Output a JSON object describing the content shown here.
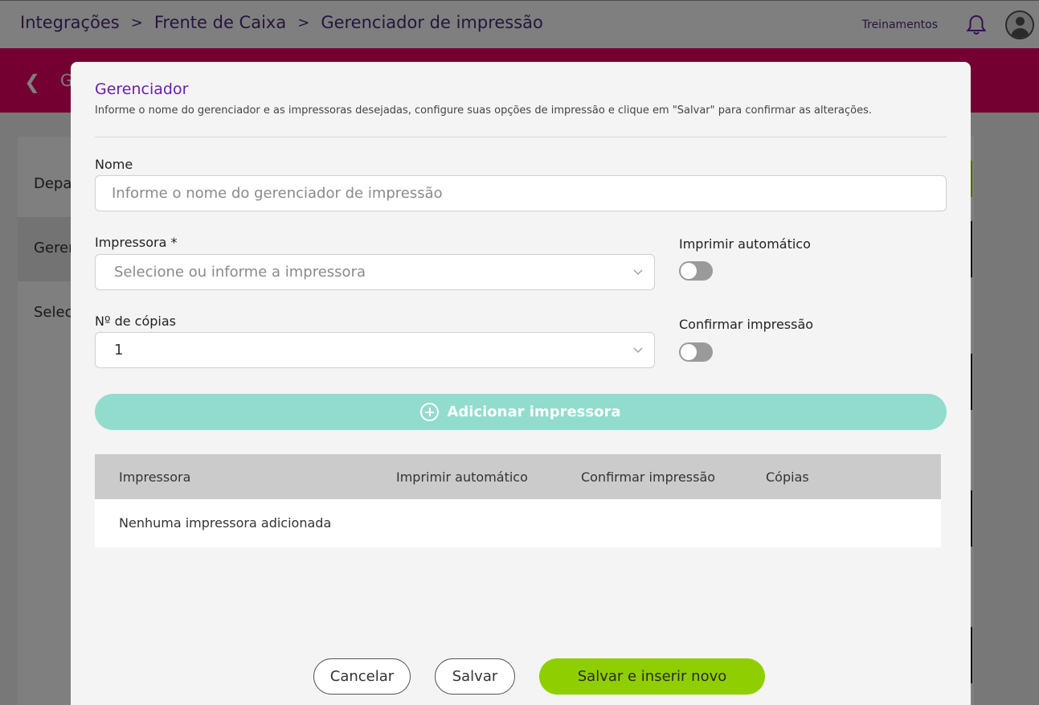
{
  "header": {
    "breadcrumb": [
      "Integrações",
      "Frente de Caixa",
      "Gerenciador de impressão"
    ],
    "breadcrumb_separator": ">",
    "training_link": "Treinamentos",
    "bell_icon": "bell-icon",
    "avatar_icon": "user-avatar-icon"
  },
  "subheader": {
    "back_icon": "chevron-left-icon",
    "title_partial": "G"
  },
  "background_sidebar": {
    "items": [
      "Depa",
      "Gerer",
      "Selec"
    ],
    "active_index": 1
  },
  "modal": {
    "title": "Gerenciador",
    "description": "Informe o nome do gerenciador e as impressoras desejadas, configure suas opções de impressão e clique em \"Salvar\" para confirmar as alterações.",
    "name_label": "Nome",
    "name_value": "",
    "name_placeholder": "Informe o nome do gerenciador de impressão",
    "printer_label": "Impressora *",
    "printer_placeholder": "Selecione ou informe a impressora",
    "copies_label": "Nº de cópias",
    "copies_value": "1",
    "auto_print_label": "Imprimir automático",
    "auto_print_on": false,
    "confirm_print_label": "Confirmar impressão",
    "confirm_print_on": false,
    "add_printer_label": "Adicionar impressora",
    "table": {
      "columns": [
        "Impressora",
        "Imprimir automático",
        "Confirmar impressão",
        "Cópias"
      ],
      "empty_message": "Nenhuma impressora adicionada"
    },
    "buttons": {
      "cancel": "Cancelar",
      "save": "Salvar",
      "save_and_new": "Salvar e inserir novo"
    }
  },
  "colors": {
    "brand_pink": "#e60060",
    "title_purple": "#6a1fa8",
    "breadcrumb_purple": "#4a2a7a",
    "add_button_teal": "#91dccd",
    "primary_green": "#8fce00"
  }
}
